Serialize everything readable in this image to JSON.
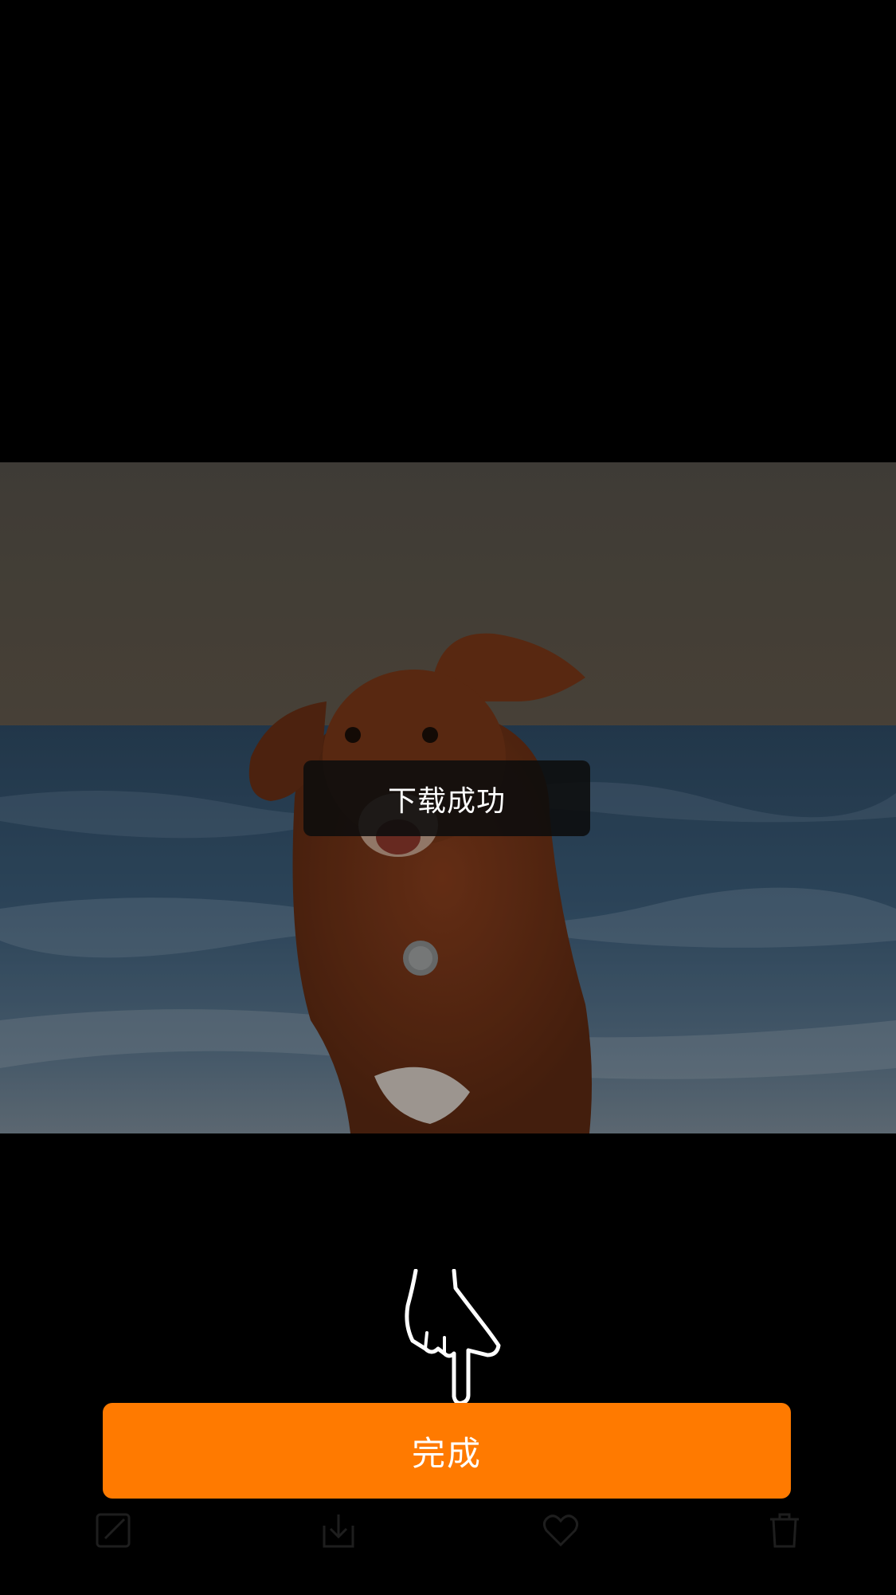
{
  "toast": {
    "text": "下载成功"
  },
  "done_button": {
    "label": "完成"
  },
  "toolbar": {
    "items": [
      {
        "icon": "edit-icon"
      },
      {
        "icon": "download-icon"
      },
      {
        "icon": "heart-icon"
      },
      {
        "icon": "trash-icon"
      }
    ]
  },
  "colors": {
    "accent": "#ff7a00",
    "background": "#000000",
    "toast_bg": "#0c0c0c"
  }
}
